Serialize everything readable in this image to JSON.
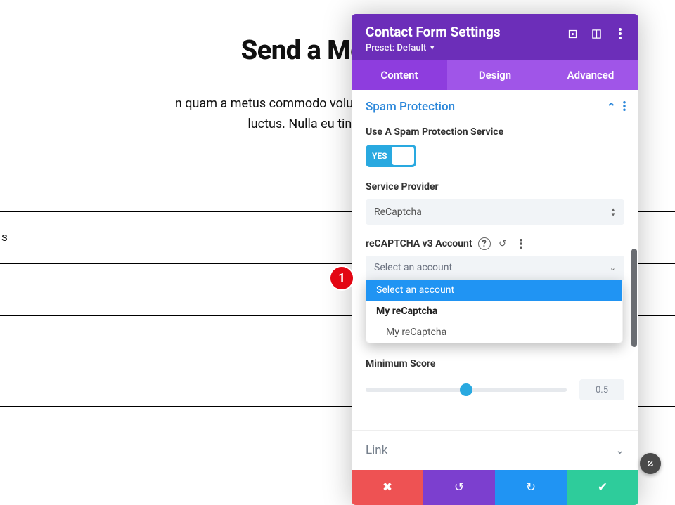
{
  "page": {
    "title": "Send a Message",
    "desc_line1": "n quam a metus commodo volutpat. Vivamus non urna sit",
    "desc_line2": "luctus. Nulla eu tincidunt lectus.",
    "field_fragment": "s"
  },
  "panel": {
    "title": "Contact Form Settings",
    "preset_label": "Preset: Default",
    "tabs": {
      "content": "Content",
      "design": "Design",
      "advanced": "Advanced"
    },
    "section": {
      "spam": {
        "title": "Spam Protection",
        "use_service_label": "Use A Spam Protection Service",
        "toggle_value": "YES",
        "provider_label": "Service Provider",
        "provider_value": "ReCaptcha",
        "account_label": "reCAPTCHA v3 Account",
        "account_select_placeholder": "Select an account",
        "dropdown": {
          "opt1": "Select an account",
          "opt2": "My reCaptcha",
          "opt3": "My reCaptcha"
        },
        "min_score_label": "Minimum Score",
        "min_score_value": "0.5"
      },
      "link": {
        "title": "Link"
      }
    }
  },
  "marker": {
    "num": "1"
  }
}
